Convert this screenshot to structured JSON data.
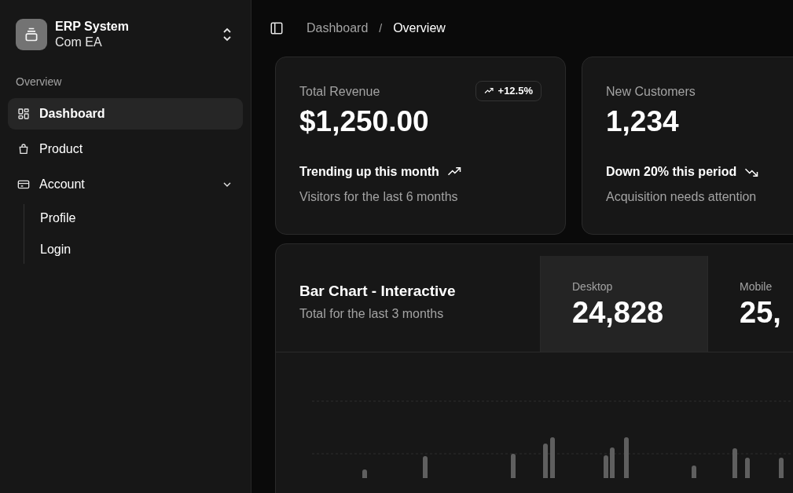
{
  "sidebar": {
    "brand": {
      "title": "ERP System",
      "subtitle": "Com EA"
    },
    "group_label": "Overview",
    "items": [
      {
        "label": "Dashboard",
        "selected": true
      },
      {
        "label": "Product",
        "selected": false
      },
      {
        "label": "Account",
        "selected": false,
        "expanded": true,
        "children": [
          {
            "label": "Profile"
          },
          {
            "label": "Login"
          }
        ]
      }
    ]
  },
  "breadcrumb": {
    "items": [
      "Dashboard",
      "Overview"
    ],
    "separator": "/"
  },
  "cards": [
    {
      "title": "Total Revenue",
      "badge": "+12.5%",
      "kind": "up",
      "value": "$1,250.00",
      "footer": "Trending up this month",
      "note": "Visitors for the last 6 months"
    },
    {
      "title": "New Customers",
      "kind": "down",
      "value": "1,234",
      "footer": "Down 20% this period",
      "note": "Acquisition needs attention"
    }
  ],
  "chart_card": {
    "title": "Bar Chart - Interactive",
    "subtitle": "Total for the last 3 months",
    "toggles": [
      {
        "label": "Desktop",
        "value": "24,828",
        "selected": true
      },
      {
        "label": "Mobile",
        "value": "25,",
        "selected": false
      }
    ]
  }
}
